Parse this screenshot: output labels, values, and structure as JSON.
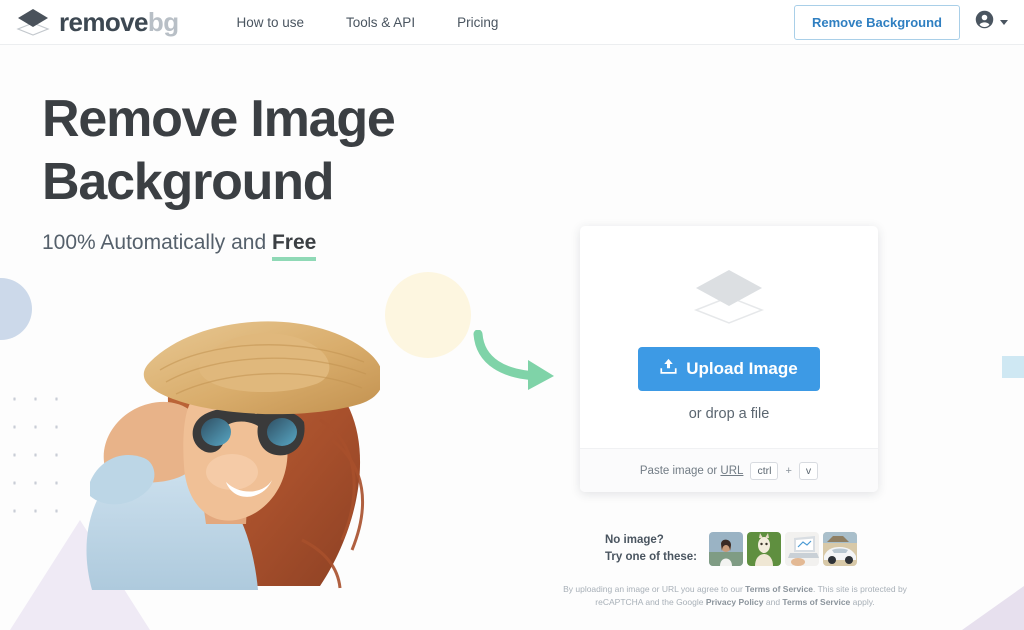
{
  "header": {
    "logo": {
      "icon": "layers-icon",
      "text_primary": "remove",
      "text_secondary": "bg"
    },
    "nav": [
      {
        "label": "How to use",
        "name": "nav-how-to-use"
      },
      {
        "label": "Tools & API",
        "name": "nav-tools-api"
      },
      {
        "label": "Pricing",
        "name": "nav-pricing"
      }
    ],
    "cta_label": "Remove Background",
    "account_icon": "account-circle-icon",
    "caret_icon": "chevron-down-icon"
  },
  "hero": {
    "title_line1": "Remove Image",
    "title_line2": "Background",
    "subtitle_prefix": "100% Automatically and ",
    "subtitle_highlight": "Free"
  },
  "upload_card": {
    "icon": "layers-icon",
    "button_label": "Upload Image",
    "button_icon": "upload-icon",
    "drop_text": "or drop a file",
    "paste_text": "Paste image or ",
    "paste_link": "URL",
    "key_ctrl": "ctrl",
    "key_plus": "+",
    "key_v": "v"
  },
  "samples": {
    "label_line1": "No image?",
    "label_line2": "Try one of these:",
    "thumbnails": [
      {
        "name": "sample-woman",
        "alt": "woman in white top"
      },
      {
        "name": "sample-alpaca",
        "alt": "alpaca on green field"
      },
      {
        "name": "sample-laptop",
        "alt": "laptop on desk"
      },
      {
        "name": "sample-car",
        "alt": "white sports car"
      }
    ]
  },
  "legal": {
    "line1_a": "By uploading an image or URL you agree to our ",
    "line1_b": "Terms of Service",
    "line1_c": ". This site is",
    "line2_a": "protected by reCAPTCHA and the Google ",
    "line2_b": "Privacy Policy",
    "line2_c": " and ",
    "line2_d": "Terms of Service",
    "line2_e": " apply."
  },
  "colors": {
    "accent_blue": "#3d9ae5",
    "cta_border": "#a9cfe8",
    "cta_text": "#2f7fc1",
    "underline_green": "#8fd9b6",
    "arrow_green": "#7fd3a8",
    "heading": "#3b3f43"
  }
}
